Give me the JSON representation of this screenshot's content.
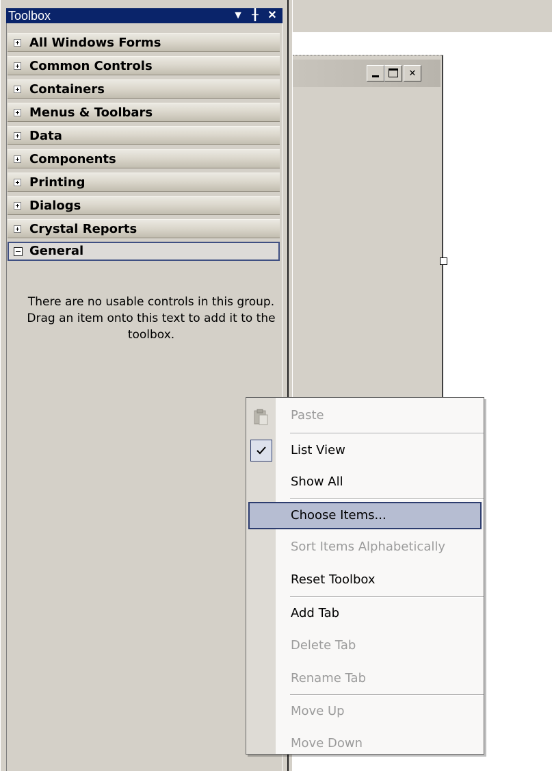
{
  "toolbox": {
    "title": "Toolbox",
    "title_buttons": {
      "dropdown": "▼",
      "pin": "╂",
      "close": "✕"
    },
    "tabs": [
      {
        "label": "All Windows Forms",
        "expanded": false
      },
      {
        "label": "Common Controls",
        "expanded": false
      },
      {
        "label": "Containers",
        "expanded": false
      },
      {
        "label": "Menus & Toolbars",
        "expanded": false
      },
      {
        "label": "Data",
        "expanded": false
      },
      {
        "label": "Components",
        "expanded": false
      },
      {
        "label": "Printing",
        "expanded": false
      },
      {
        "label": "Dialogs",
        "expanded": false
      },
      {
        "label": "Crystal Reports",
        "expanded": false
      },
      {
        "label": "General",
        "expanded": true,
        "selected": true
      }
    ],
    "empty_message": "There are no usable controls in this group. Drag an item onto this text to add it to the toolbox."
  },
  "form_window": {
    "close_glyph": "✕"
  },
  "context_menu": {
    "items": [
      {
        "label": "Paste",
        "enabled": false,
        "icon": "paste-icon"
      },
      {
        "label": "List View",
        "enabled": true,
        "checked": true
      },
      {
        "label": "Show All",
        "enabled": true
      },
      {
        "label": "Choose Items...",
        "enabled": true,
        "highlighted": true
      },
      {
        "label": "Sort Items Alphabetically",
        "enabled": false
      },
      {
        "label": "Reset Toolbox",
        "enabled": true
      },
      {
        "label": "Add Tab",
        "enabled": true
      },
      {
        "label": "Delete Tab",
        "enabled": false
      },
      {
        "label": "Rename Tab",
        "enabled": false
      },
      {
        "label": "Move Up",
        "enabled": false
      },
      {
        "label": "Move Down",
        "enabled": false
      }
    ]
  },
  "colors": {
    "title_bar": "#0a246a",
    "menu_highlight": "#b6bdd2",
    "menu_highlight_border": "#2c3c6e",
    "disabled_text": "#9b9b9b",
    "panel_bg": "#d4d0c8"
  }
}
